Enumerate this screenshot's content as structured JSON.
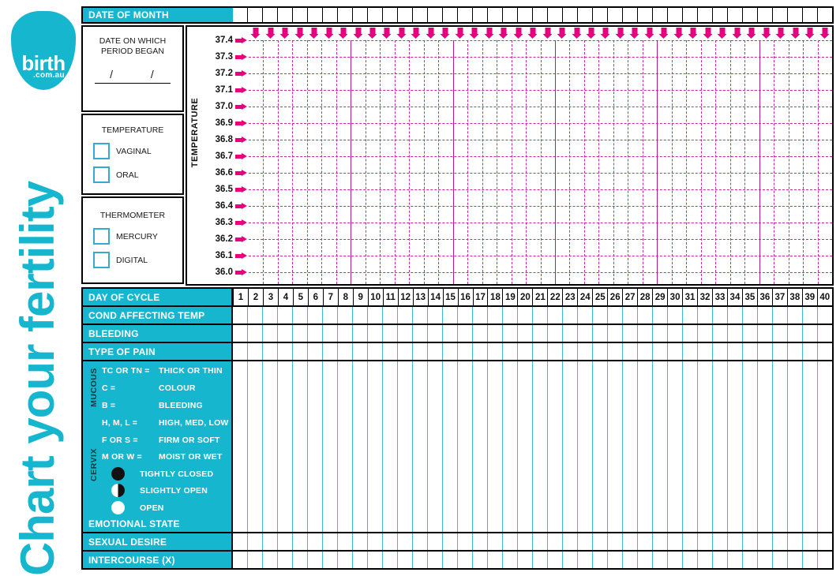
{
  "brand": {
    "logo_word": "birth",
    "logo_domain": ".com.au",
    "vertical_title": "Chart your fertility",
    "accent_color": "#17b6cf",
    "grid_color": "#c8299a"
  },
  "date_of_month": {
    "label": "DATE OF MONTH",
    "cell_count": 40
  },
  "period_box": {
    "title_line1": "DATE ON WHICH",
    "title_line2": "PERIOD BEGAN",
    "slashes": "/   /"
  },
  "temperature_box": {
    "title": "TEMPERATURE",
    "options": [
      "VAGINAL",
      "ORAL"
    ]
  },
  "thermometer_box": {
    "title": "THERMOMETER",
    "options": [
      "MERCURY",
      "DIGITAL"
    ]
  },
  "graph": {
    "y_axis_title": "TEMPERATURE",
    "y_ticks": [
      "37.4",
      "37.3",
      "37.2",
      "37.1",
      "37.0",
      "36.9",
      "36.8",
      "36.7",
      "36.6",
      "36.5",
      "36.4",
      "36.3",
      "36.2",
      "36.1",
      "36.0"
    ],
    "columns": 40,
    "week_markers": [
      7,
      14,
      21,
      28,
      35
    ]
  },
  "chart_data": {
    "type": "table",
    "title": "Chart your fertility",
    "ylabel": "TEMPERATURE",
    "xlabel": "DAY OF CYCLE",
    "ylim": [
      36.0,
      37.4
    ],
    "y_ticks": [
      37.4,
      37.3,
      37.2,
      37.1,
      37.0,
      36.9,
      36.8,
      36.7,
      36.6,
      36.5,
      36.4,
      36.3,
      36.2,
      36.1,
      36.0
    ],
    "x": [
      1,
      2,
      3,
      4,
      5,
      6,
      7,
      8,
      9,
      10,
      11,
      12,
      13,
      14,
      15,
      16,
      17,
      18,
      19,
      20,
      21,
      22,
      23,
      24,
      25,
      26,
      27,
      28,
      29,
      30,
      31,
      32,
      33,
      34,
      35,
      36,
      37,
      38,
      39,
      40
    ],
    "series": [],
    "grid": true,
    "legend": "none",
    "note": "Blank printable tracking chart - no plotted data points"
  },
  "table": {
    "day_header": "DAY OF CYCLE",
    "days": [
      1,
      2,
      3,
      4,
      5,
      6,
      7,
      8,
      9,
      10,
      11,
      12,
      13,
      14,
      15,
      16,
      17,
      18,
      19,
      20,
      21,
      22,
      23,
      24,
      25,
      26,
      27,
      28,
      29,
      30,
      31,
      32,
      33,
      34,
      35,
      36,
      37,
      38,
      39,
      40
    ],
    "simple_rows": [
      "COND AFFECTING TEMP",
      "BLEEDING",
      "TYPE OF PAIN"
    ],
    "mucous": {
      "tag": "MUCOUS",
      "lines": [
        {
          "key": "TC OR TN =",
          "value": "THICK OR THIN"
        },
        {
          "key": "C =",
          "value": "COLOUR"
        },
        {
          "key": "B =",
          "value": "BLEEDING"
        }
      ]
    },
    "cervix": {
      "tag": "CERVIX",
      "lines": [
        {
          "key": "H, M, L =",
          "value": "HIGH, MED, LOW"
        },
        {
          "key": "F OR S =",
          "value": "FIRM OR SOFT"
        },
        {
          "key": "M OR W =",
          "value": "MOIST OR WET"
        }
      ],
      "symbols": [
        {
          "icon": "filled-circle",
          "label": "TIGHTLY CLOSED"
        },
        {
          "icon": "half-filled-circle",
          "label": "SLIGHTLY OPEN"
        },
        {
          "icon": "empty-circle",
          "label": "OPEN"
        }
      ]
    },
    "bottom_rows": [
      "EMOTIONAL STATE",
      "SEXUAL DESIRE",
      "INTERCOURSE (X)"
    ]
  }
}
